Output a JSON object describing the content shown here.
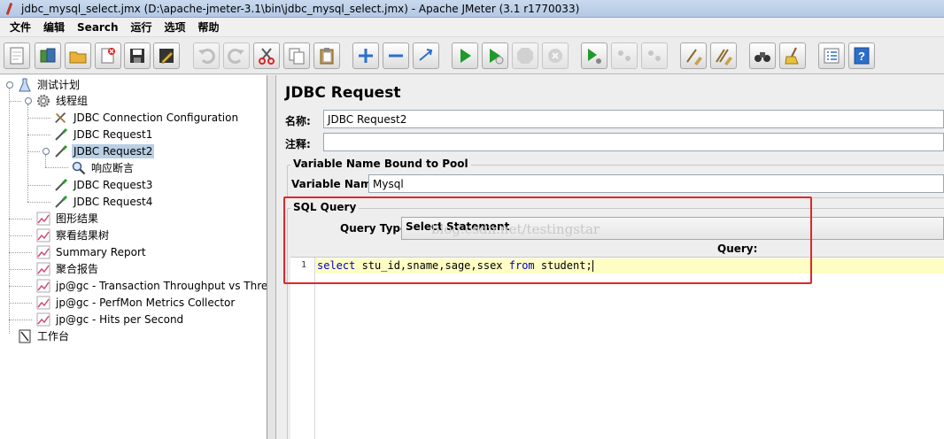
{
  "window": {
    "title": "jdbc_mysql_select.jmx (D:\\apache-jmeter-3.1\\bin\\jdbc_mysql_select.jmx) - Apache JMeter (3.1 r1770033)"
  },
  "menu": [
    "文件",
    "编辑",
    "Search",
    "运行",
    "选项",
    "帮助"
  ],
  "toolbar": [
    {
      "icon": "new-file-icon"
    },
    {
      "icon": "templates-icon"
    },
    {
      "icon": "open-folder-icon"
    },
    {
      "icon": "close-file-icon"
    },
    {
      "icon": "save-icon"
    },
    {
      "icon": "save-as-icon"
    },
    {
      "icon": "undo-icon"
    },
    {
      "icon": "redo-icon"
    },
    {
      "icon": "cut-icon"
    },
    {
      "icon": "copy-icon"
    },
    {
      "icon": "paste-icon"
    },
    {
      "icon": "expand-icon"
    },
    {
      "icon": "collapse-icon"
    },
    {
      "icon": "toggle-icon"
    },
    {
      "icon": "start-icon"
    },
    {
      "icon": "start-no-pause-icon"
    },
    {
      "icon": "stop-icon"
    },
    {
      "icon": "shutdown-icon"
    },
    {
      "icon": "remote-start-icon"
    },
    {
      "icon": "remote-stop-icon"
    },
    {
      "icon": "remote-shutdown-icon"
    },
    {
      "icon": "clear-icon"
    },
    {
      "icon": "clear-all-icon"
    },
    {
      "icon": "search-binoculars-icon"
    },
    {
      "icon": "reset-search-broom-icon"
    },
    {
      "icon": "function-helper-icon"
    },
    {
      "icon": "help-icon"
    }
  ],
  "tree": {
    "test_plan": "测试计划",
    "thread_group": "线程组",
    "jdbc_connection": "JDBC Connection Configuration",
    "jdbc_request1": "JDBC Request1",
    "jdbc_request2": "JDBC Request2",
    "response_assertion": "响应断言",
    "jdbc_request3": "JDBC Request3",
    "jdbc_request4": "JDBC Request4",
    "graph_results": "图形结果",
    "view_results_tree": "察看结果树",
    "summary_report": "Summary Report",
    "aggregate_report": "聚合报告",
    "transaction_throughput": "jp@gc - Transaction Throughput vs Thread",
    "perfmon": "jp@gc - PerfMon Metrics Collector",
    "hits_per_second": "jp@gc - Hits per Second",
    "workbench": "工作台"
  },
  "panel": {
    "title": "JDBC Request",
    "name_label": "名称:",
    "name_value": "JDBC Request2",
    "comment_label": "注释:",
    "comment_value": "",
    "pool_group": "Variable Name Bound to Pool",
    "pool_label": "Variable Name:",
    "pool_value": "Mysql",
    "sql_group": "SQL Query",
    "query_type_label": "Query Type:",
    "query_type_value": "Select Statement",
    "watermark": "blog.csdn.net/testingstar",
    "query_label": "Query:",
    "query_line_number": "1",
    "query_code": {
      "k1": "select",
      "t1": " stu_id,sname,sage,ssex ",
      "k2": "from",
      "t2": " student;"
    }
  },
  "colors": {
    "highlight_box": "#e0262b",
    "selection": "#b8cfe5",
    "keyword": "#0000c8",
    "current_line": "#fdfdc4"
  }
}
